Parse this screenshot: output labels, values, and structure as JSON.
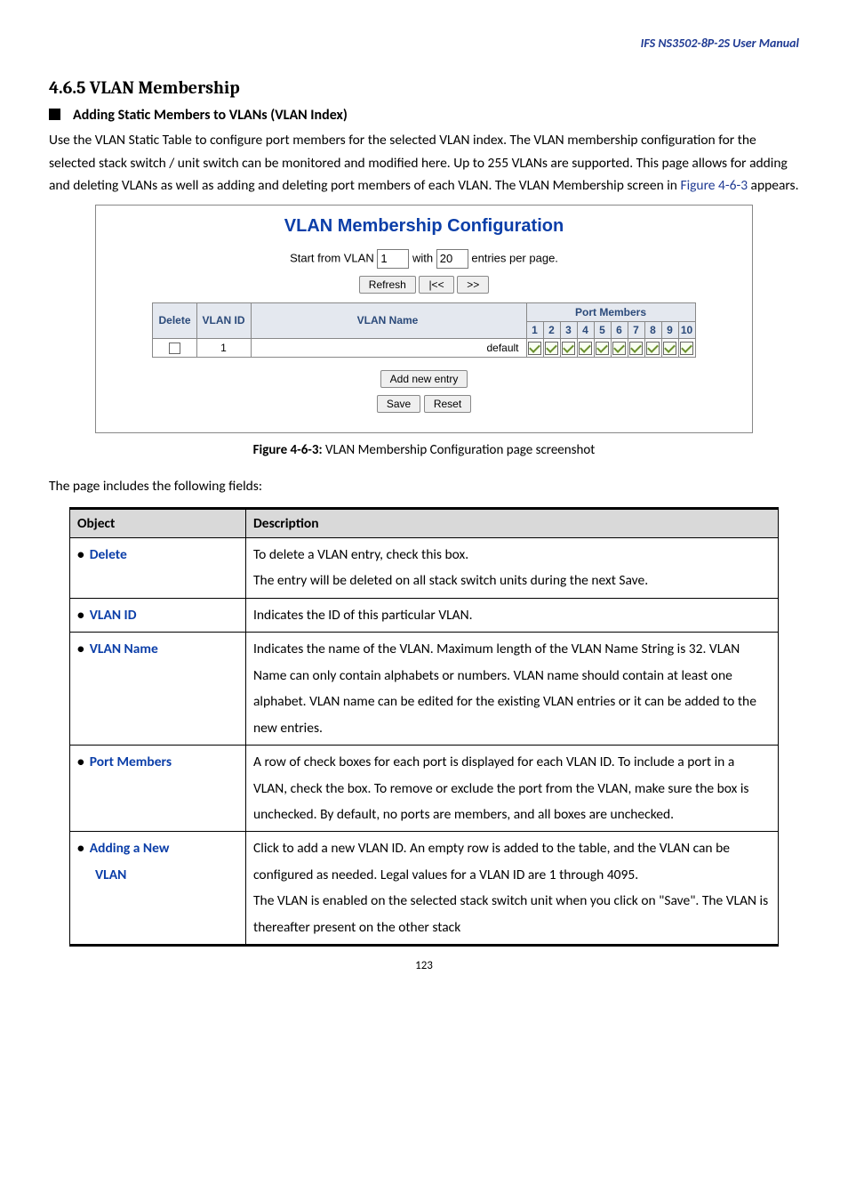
{
  "header": {
    "manual": "IFS  NS3502-8P-2S  User  Manual"
  },
  "section": {
    "number": "4.6.5",
    "title": "VLAN Membership",
    "subhead": "Adding Static Members to VLANs (VLAN Index)",
    "para_a": "Use the VLAN Static Table to configure port members for the selected VLAN index. The VLAN membership configuration for the selected stack switch / unit switch can be monitored and modified here. Up to 255 VLANs are supported. This page allows for adding and deleting VLANs as well as adding and deleting port members of each VLAN. The VLAN Membership screen in ",
    "para_link": "Figure 4-6-3",
    "para_b": " appears."
  },
  "panel": {
    "title": "VLAN Membership Configuration",
    "start_label": "Start from VLAN",
    "start_value": "1",
    "with_label": "with",
    "with_value": "20",
    "entries_label": "entries per page.",
    "refresh": "Refresh",
    "prev": "|<<",
    "next": ">>",
    "port_members_heading": "Port Members",
    "col_delete": "Delete",
    "col_vlan_id": "VLAN ID",
    "col_vlan_name": "VLAN Name",
    "ports": [
      "1",
      "2",
      "3",
      "4",
      "5",
      "6",
      "7",
      "8",
      "9",
      "10"
    ],
    "row1": {
      "vlan_id": "1",
      "vlan_name": "default",
      "delete_checked": false,
      "ports_checked": [
        true,
        true,
        true,
        true,
        true,
        true,
        true,
        true,
        true,
        true
      ]
    },
    "add_new": "Add new entry",
    "save": "Save",
    "reset": "Reset"
  },
  "figure_caption": {
    "bold": "Figure 4-6-3:",
    "rest": " VLAN Membership Configuration page screenshot"
  },
  "fields_intro": "The page includes the following fields:",
  "desc_table": {
    "head_object": "Object",
    "head_desc": "Description",
    "rows": [
      {
        "label": "Delete",
        "desc": "To delete a VLAN entry, check this box.\nThe entry will be deleted on all stack switch units during the next Save."
      },
      {
        "label": "VLAN ID",
        "desc": "Indicates the ID of this particular VLAN."
      },
      {
        "label": "VLAN Name",
        "desc": "Indicates the name of the VLAN. Maximum length of the VLAN Name String is 32. VLAN Name can only contain alphabets or numbers. VLAN name should contain at least one alphabet. VLAN name can be edited for the existing VLAN entries or it can be added to the new entries."
      },
      {
        "label": "Port Members",
        "desc": "A row of check boxes for each port is displayed for each VLAN ID. To include a port in a VLAN, check the box. To remove or exclude the port from the VLAN, make sure the box is unchecked. By default, no ports are members, and all boxes are unchecked."
      },
      {
        "label": "Adding a New",
        "label2": "VLAN",
        "desc": "Click to add a new VLAN ID. An empty row is added to the table, and the VLAN can be configured as needed. Legal values for a VLAN ID are 1 through 4095.\nThe VLAN is enabled on the selected stack switch unit when you click on \"Save\". The VLAN is thereafter present on the other stack"
      }
    ]
  },
  "footer": {
    "page_no": "123"
  }
}
